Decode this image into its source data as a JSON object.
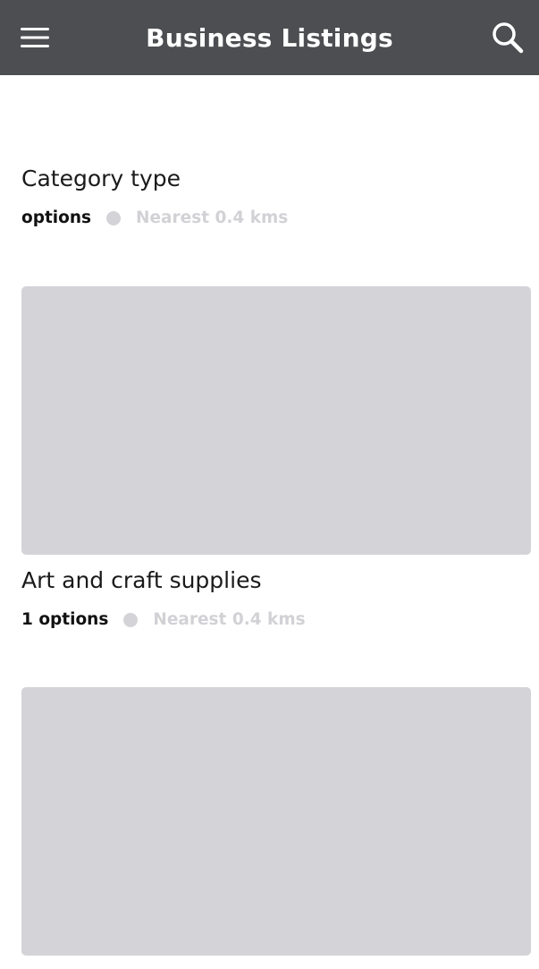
{
  "header": {
    "title": "Business Listings",
    "menu_icon": "hamburger-menu-icon",
    "search_icon": "search-icon",
    "background": "#4d4e52"
  },
  "categories": [
    {
      "title": "Category type",
      "options": "options",
      "distance": "Nearest 0.4 kms"
    },
    {
      "title": "Art and craft supplies",
      "options": "1 options",
      "distance": "Nearest 0.4 kms"
    }
  ],
  "colors": {
    "placeholder": "#d4d3d8",
    "dot": "#d4d4d8",
    "muted_text": "#d2d2d6"
  }
}
